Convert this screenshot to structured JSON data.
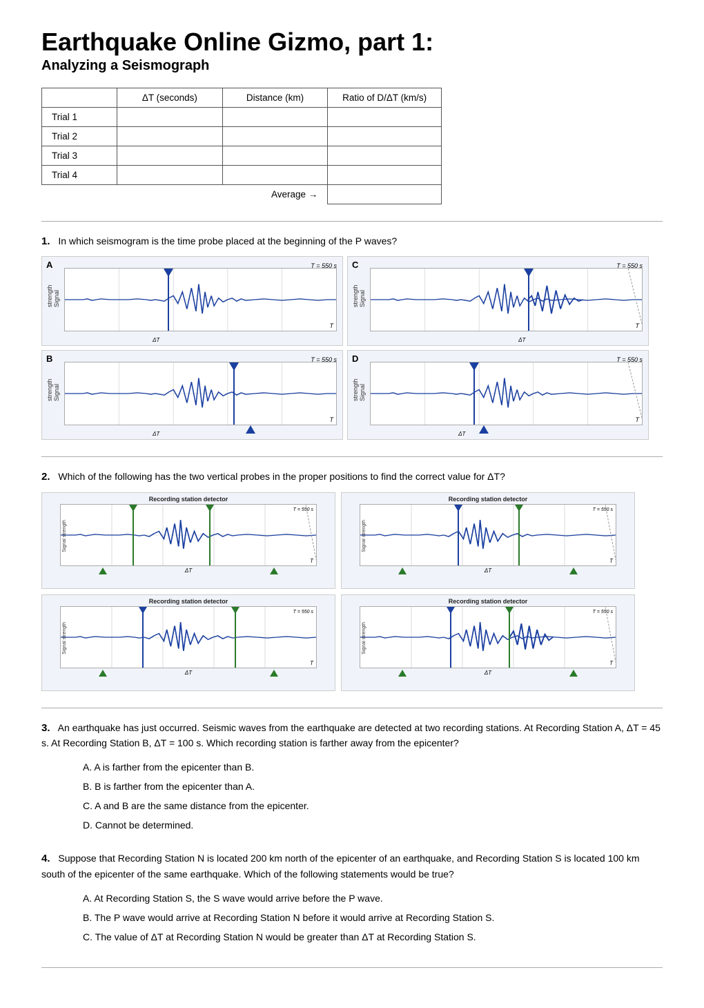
{
  "title": "Earthquake Online Gizmo, part 1:",
  "subtitle": "Analyzing a Seismograph",
  "table": {
    "headers": [
      "",
      "ΔT (seconds)",
      "Distance (km)",
      "Ratio of D/ΔT (km/s)"
    ],
    "rows": [
      "Trial 1",
      "Trial 2",
      "Trial 3",
      "Trial 4"
    ],
    "avg_label": "Average →"
  },
  "q1": {
    "number": "1.",
    "text": "In which seismogram is the time probe placed at the beginning of the P waves?",
    "panels": [
      {
        "label": "A",
        "t_label": "T = 550 s",
        "probe_pos": 0.38
      },
      {
        "label": "C",
        "t_label": "T = 550 s",
        "probe_pos": 0.58
      },
      {
        "label": "B",
        "t_label": "T = 550 s",
        "probe_pos": 0.38
      },
      {
        "label": "D",
        "t_label": "T = 550 s",
        "probe_pos": 0.38
      }
    ]
  },
  "q2": {
    "number": "2.",
    "text": "Which of the following has the two vertical probes in the proper positions to find the correct value for ΔT?",
    "panels": [
      {
        "label": "top-left",
        "title": "Recording station detector"
      },
      {
        "label": "top-right",
        "title": "Recording station detector"
      },
      {
        "label": "bottom-left",
        "title": "Recording station detector"
      },
      {
        "label": "bottom-right",
        "title": "Recording station detector"
      }
    ]
  },
  "q3": {
    "number": "3.",
    "text": "An earthquake has just occurred. Seismic waves from the earthquake are detected at two recording stations. At Recording Station A, ΔT = 45 s. At Recording Station B, ΔT = 100 s. Which recording station is farther away from the epicenter?",
    "choices": [
      "A.  A is farther from the epicenter than B.",
      "B.  B is farther from the epicenter than A.",
      "C.  A and B are the same distance from the epicenter.",
      "D.  Cannot be determined."
    ]
  },
  "q4": {
    "number": "4.",
    "text": "Suppose that Recording Station N is located 200 km north of the epicenter of an earthquake, and Recording Station S is located 100 km south of the epicenter of the same earthquake. Which of the following statements would be true?",
    "choices": [
      "A.  At Recording Station S, the S wave would arrive before the P wave.",
      "B.  The P wave would arrive at Recording Station N before it would arrive at Recording Station S.",
      "C.  The value of ΔT at Recording Station N would be greater than ΔT at Recording Station S."
    ]
  }
}
